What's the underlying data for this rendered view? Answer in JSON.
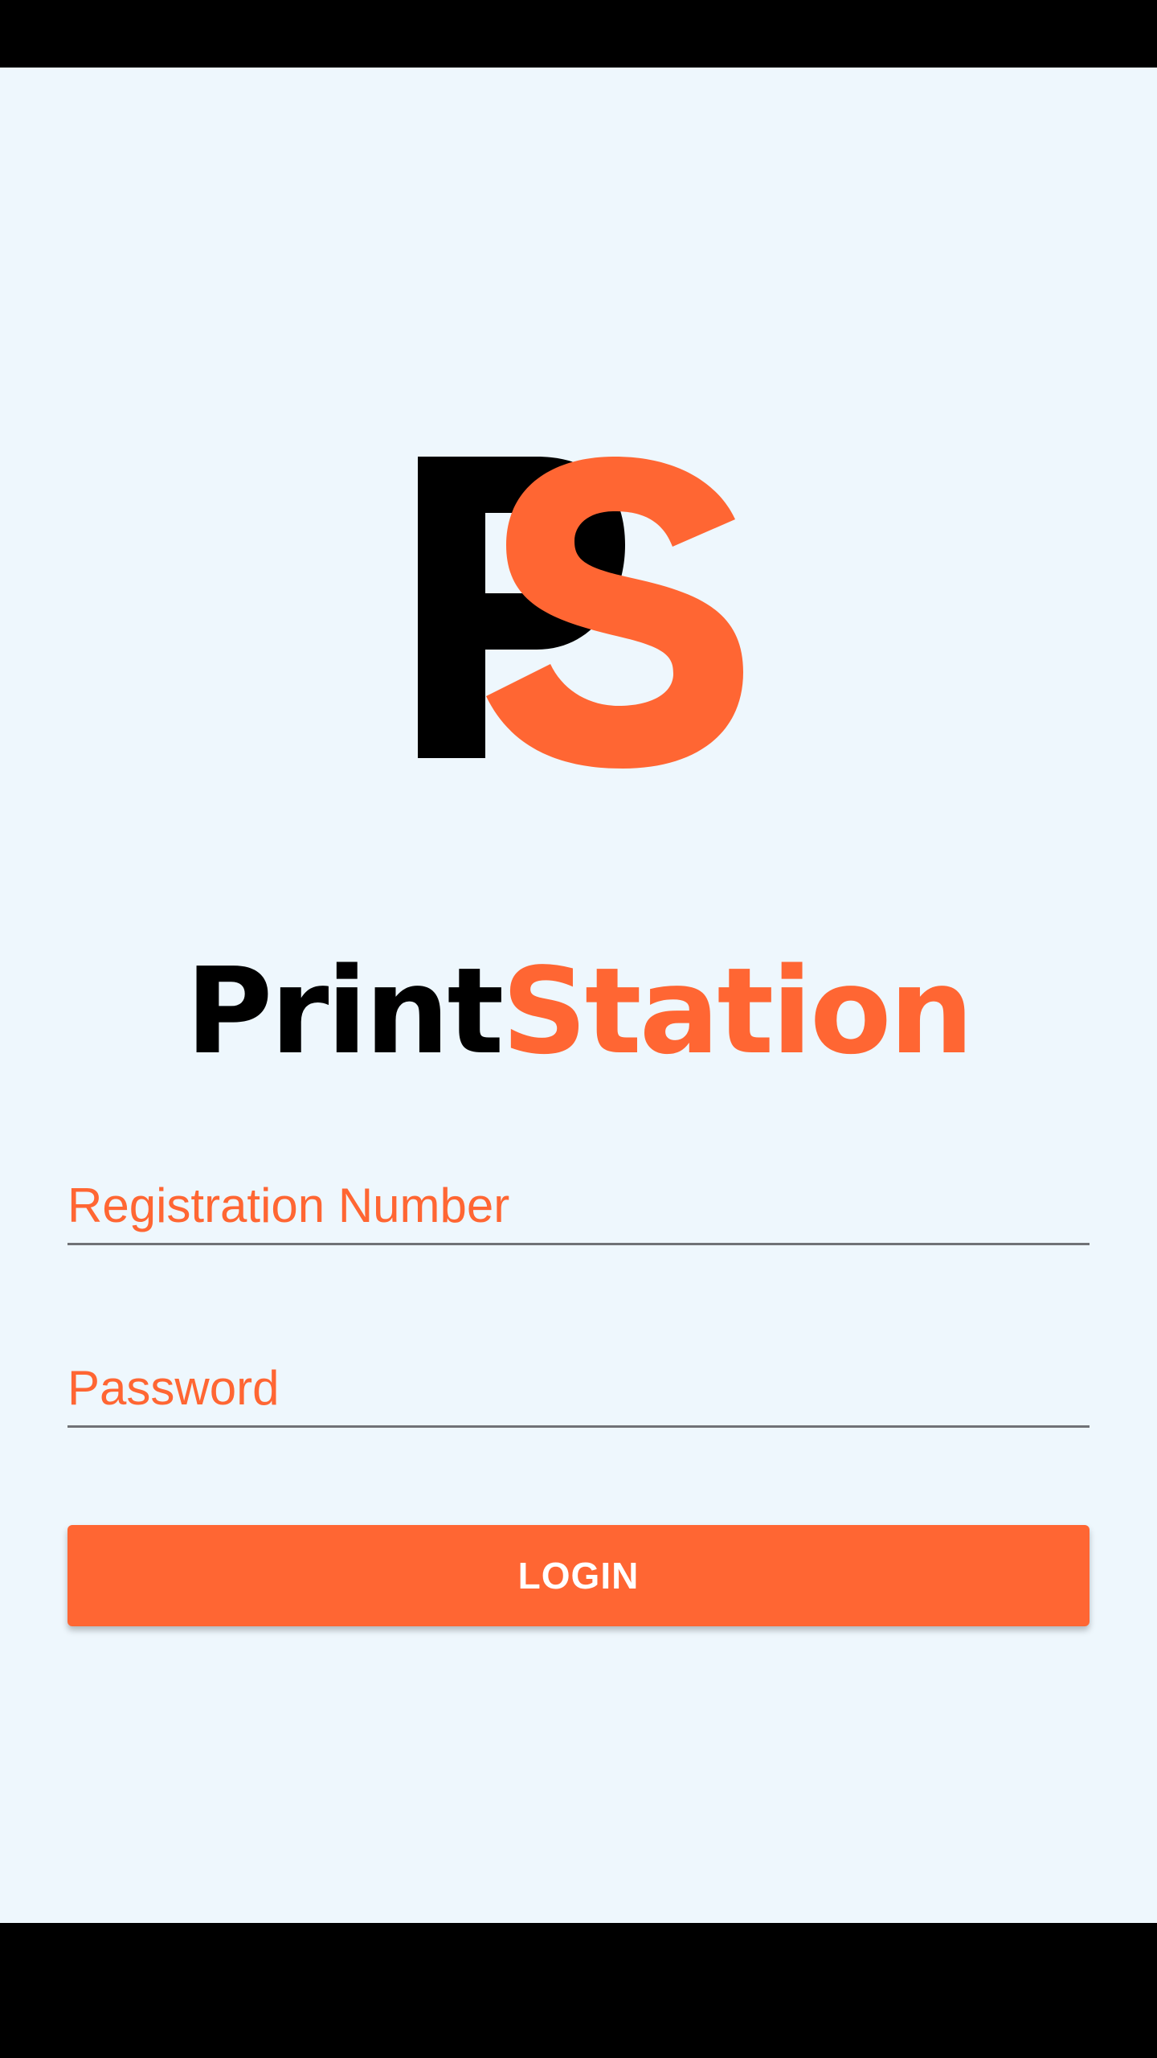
{
  "app": {
    "brand_part1": "Print",
    "brand_part2": "Station",
    "logo": "PS-logo",
    "colors": {
      "accent": "#FF6633",
      "background": "#EEF7FD",
      "text": "#000000",
      "underline": "#707276"
    }
  },
  "form": {
    "registration_placeholder": "Registration Number",
    "password_placeholder": "Password",
    "login_label": "LOGIN"
  }
}
